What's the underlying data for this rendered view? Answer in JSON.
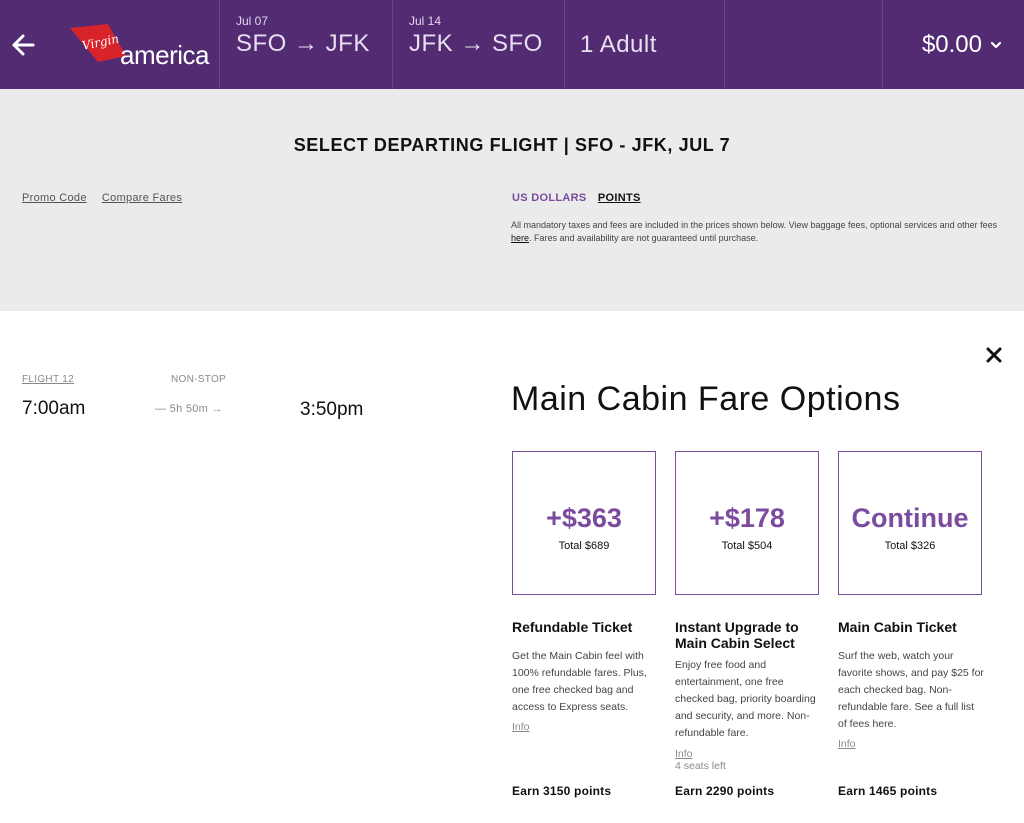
{
  "header": {
    "logo_text": "america",
    "logo_script": "Virgin",
    "trips": [
      {
        "date": "Jul 07",
        "route": "SFO → JFK"
      },
      {
        "date": "Jul 14",
        "route": "JFK → SFO"
      }
    ],
    "passengers": "1 Adult",
    "total": "$0.00",
    "colors": {
      "header_bg": "#522b72",
      "accent": "#7a4b9e",
      "logo_red": "#d8232a"
    }
  },
  "band": {
    "title": "SELECT DEPARTING FLIGHT | SFO - JFK, JUL 7",
    "promo_code": "Promo Code",
    "compare_fares": "Compare Fares",
    "currency_usd": "US DOLLARS",
    "currency_points": "POINTS",
    "fine_print_1": "All mandatory taxes and fees are included in the prices shown below. View baggage fees, optional services and other fees ",
    "fine_print_link": "here",
    "fine_print_2": ". Fares and availability are not guaranteed until purchase."
  },
  "flight": {
    "number": "FLIGHT 12",
    "stops": "NON-STOP",
    "depart": "7:00am",
    "duration": "— 5h 50m →",
    "arrive": "3:50pm"
  },
  "fares": {
    "title": "Main Cabin Fare Options",
    "options": [
      {
        "price": "+$363",
        "total": "Total $689",
        "name": "Refundable Ticket",
        "description": "Get the Main Cabin feel with 100% refundable fares. Plus, one free checked bag and access to Express seats.",
        "info": "Info",
        "earn": "Earn 3150 points"
      },
      {
        "price": "+$178",
        "total": "Total $504",
        "name": "Instant Upgrade to Main Cabin Select",
        "description": "Enjoy free food and entertainment, one free checked bag, priority boarding and security, and more. Non-refundable fare.",
        "info": "Info",
        "seats": "4 seats left",
        "earn": "Earn 2290 points"
      },
      {
        "price": "Continue",
        "total": "Total $326",
        "name": "Main Cabin Ticket",
        "description": "Surf the web, watch your favorite shows, and pay $25 for each checked bag. Non-refundable fare. See a full list of fees here.",
        "info": "Info",
        "earn": "Earn 1465 points"
      }
    ]
  },
  "icons": {
    "back": "arrow-left-icon",
    "close": "close-icon",
    "total_dropdown": "chevron-down-icon"
  }
}
